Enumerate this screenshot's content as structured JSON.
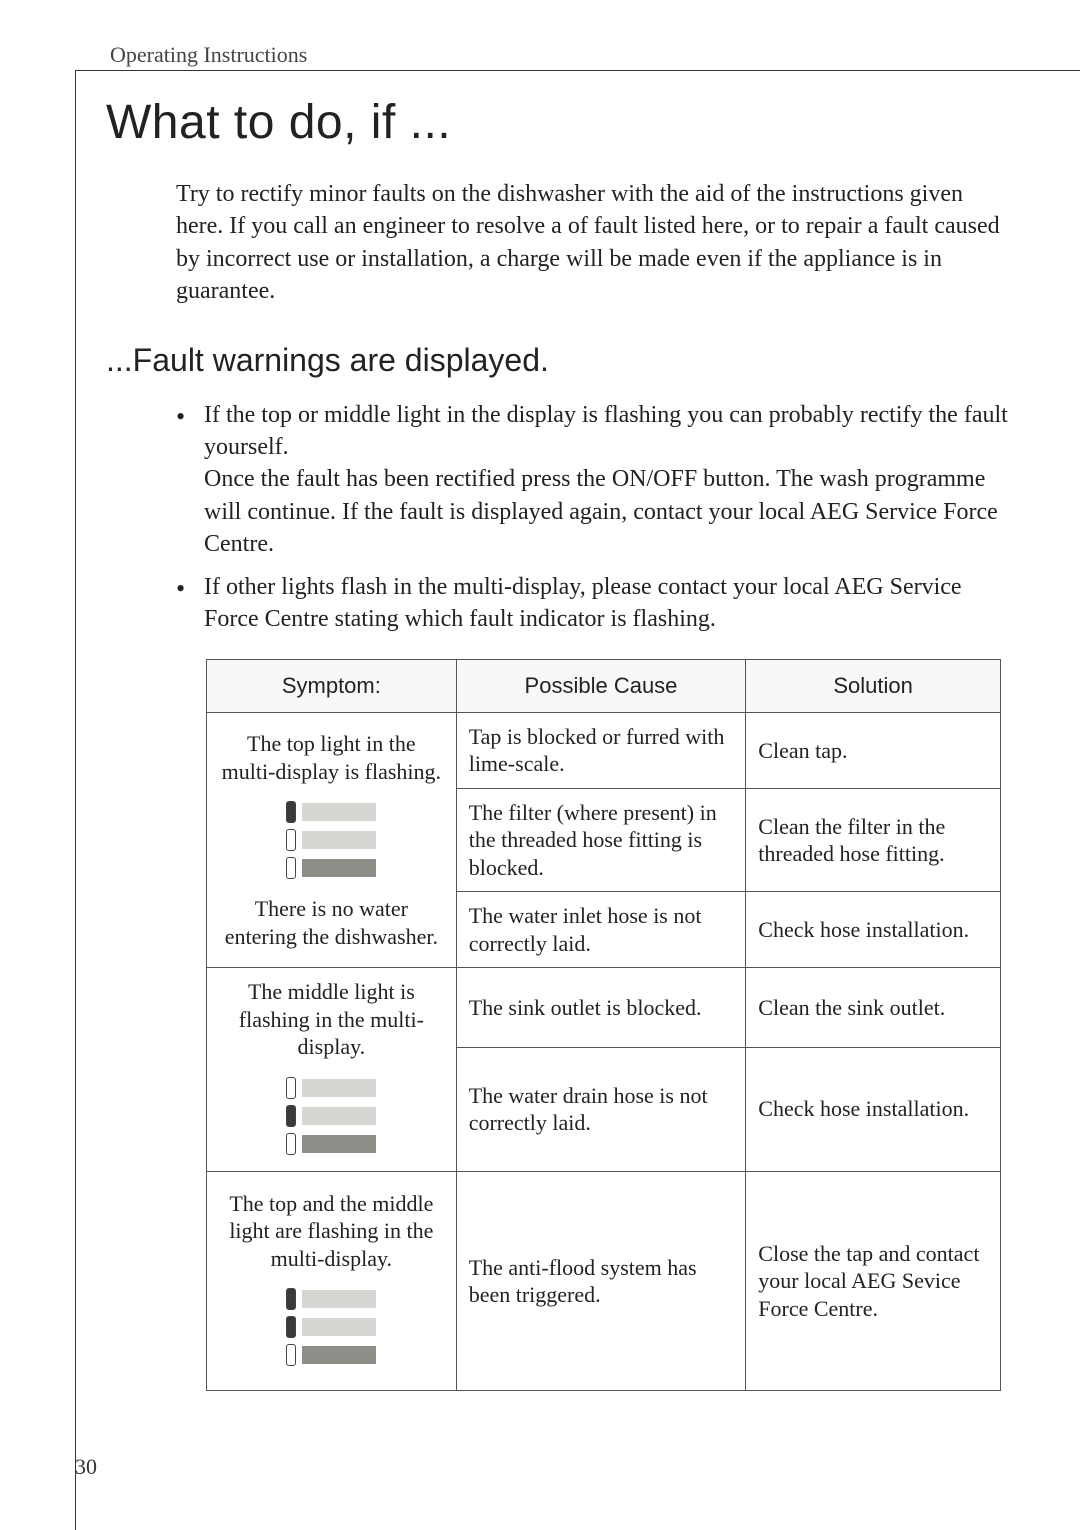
{
  "running_head": "Operating Instructions",
  "page_number": "30",
  "title": "What to do, if ...",
  "intro": "Try to rectify minor faults on the dishwasher with the aid of the instructions given here. If you call an engineer to resolve a of fault listed here, or to repair a fault caused by incorrect use or installation, a charge will be made even if the appliance is in guarantee.",
  "subheading": "...Fault warnings are displayed.",
  "bullets": [
    "If the top or middle light in the display is flashing you can probably rectify the fault yourself.\nOnce the fault has been rectified press the ON/OFF button. The wash programme will continue. If the fault is displayed again, contact your local AEG Service Force Centre.",
    "If other lights flash in the multi-display, please contact your local AEG Service Force Centre stating which fault indicator is flashing."
  ],
  "table": {
    "headers": {
      "symptom": "Symptom:",
      "cause": "Possible Cause",
      "solution": "Solution"
    },
    "groups": [
      {
        "symptom_text_top": "The top light in the multi-display is flashing.",
        "symptom_text_bottom": "There is no water entering the dishwasher.",
        "indicator": [
          true,
          false,
          false
        ],
        "rows": [
          {
            "cause": "Tap is blocked or furred with lime-scale.",
            "solution": "Clean tap."
          },
          {
            "cause": "The filter (where present) in the threaded hose fitting is blocked.",
            "solution": "Clean the filter in the threaded hose fitting."
          },
          {
            "cause": "The water inlet hose is not correctly laid.",
            "solution": "Check hose installation."
          }
        ]
      },
      {
        "symptom_text_top": "The middle light is flashing in the multi-display.",
        "indicator": [
          false,
          true,
          false
        ],
        "rows": [
          {
            "cause": "The sink outlet is blocked.",
            "solution": "Clean the sink outlet."
          },
          {
            "cause": "The water drain hose is not correctly laid.",
            "solution": "Check hose installation."
          }
        ]
      },
      {
        "symptom_text_top": "The top and the middle light are flashing in the multi-display.",
        "indicator": [
          true,
          true,
          false
        ],
        "rows": [
          {
            "cause": "The anti-flood system has been triggered.",
            "solution": "Close the tap and contact your local AEG Sevice Force Centre."
          }
        ]
      }
    ]
  }
}
